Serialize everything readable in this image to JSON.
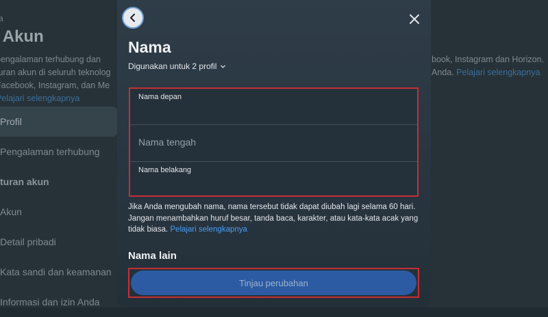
{
  "background": {
    "breadcrumb": "a",
    "title": "t Akun",
    "description_lines": [
      "pengalaman terhubung dan",
      "turan akun di seluruh teknolog",
      "Facebook, Instagram, dan Me"
    ],
    "description_link": "Pelajari selengkapnya",
    "nav_items": [
      {
        "label": "Profil",
        "active": true
      },
      {
        "label": "Pengalaman terhubung"
      },
      {
        "label": "turan akun",
        "group": true
      },
      {
        "label": "Akun"
      },
      {
        "label": "Detail pribadi"
      },
      {
        "label": "Kata sandi dan keamanan"
      },
      {
        "label": "Informasi dan izin Anda"
      }
    ],
    "right_lines": [
      "book, Instagram dan Horizon.",
      "Anda."
    ],
    "right_link": "Pelajari selengkapnya"
  },
  "modal": {
    "back_icon": "chevron-left-icon",
    "close_icon": "close-icon",
    "title": "Nama",
    "used_for": "Digunakan untuk 2 profil",
    "fields": {
      "first_name": {
        "label": "Nama depan",
        "value": ""
      },
      "middle_name": {
        "placeholder": "Nama tengah"
      },
      "last_name": {
        "label": "Nama belakang",
        "value": ""
      }
    },
    "notice": "Jika Anda mengubah nama, nama tersebut tidak dapat diubah lagi selama 60 hari. Jangan menambahkan huruf besar, tanda baca, karakter, atau kata-kata acak yang tidak biasa.",
    "notice_link": "Pelajari selengkapnya",
    "other_names_title": "Nama lain",
    "submit_label": "Tinjau perubahan"
  },
  "colors": {
    "highlight_border": "#c72e36",
    "link": "#4a9ff5",
    "primary_button": "#2c5ba3"
  }
}
